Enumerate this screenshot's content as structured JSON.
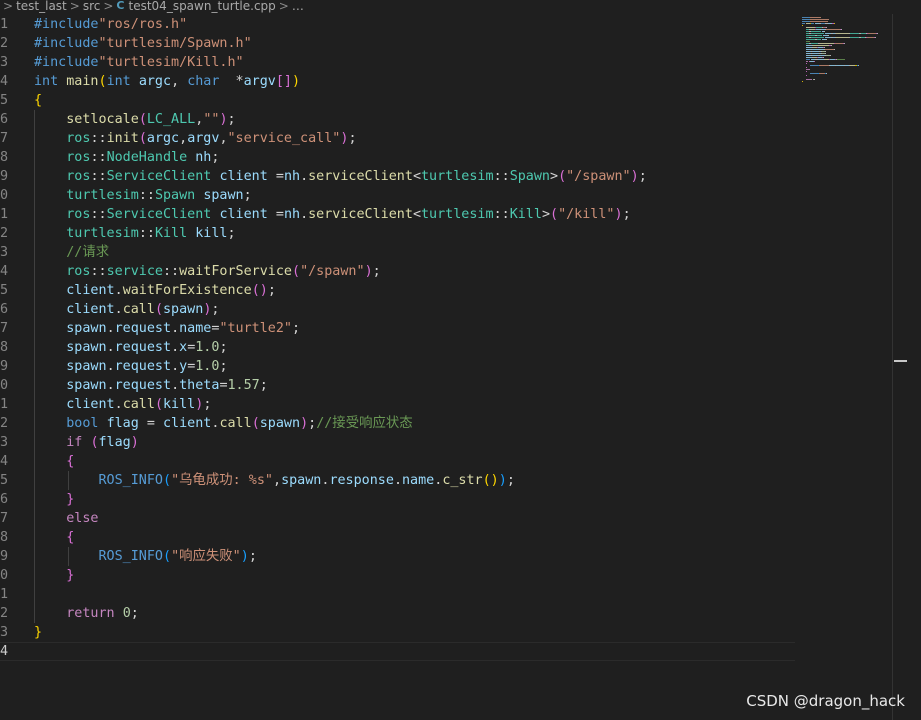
{
  "breadcrumb": {
    "items": [
      "test_last",
      "src",
      "test04_spawn_turtle.cpp",
      "…"
    ],
    "file_icon": "C",
    "separator": ">"
  },
  "editor": {
    "line_numbers": [
      "1",
      "2",
      "3",
      "4",
      "5",
      "6",
      "7",
      "8",
      "9",
      "0",
      "1",
      "2",
      "3",
      "4",
      "5",
      "6",
      "7",
      "8",
      "9",
      "0",
      "1",
      "2",
      "3",
      "4",
      "5",
      "6",
      "7",
      "8",
      "9",
      "0",
      "1",
      "2",
      "3",
      "4"
    ],
    "lines": [
      [
        [
          "mac",
          "#include"
        ],
        [
          "str",
          "\"ros/ros.h\""
        ]
      ],
      [
        [
          "mac",
          "#include"
        ],
        [
          "str",
          "\"turtlesim/Spawn.h\""
        ]
      ],
      [
        [
          "mac",
          "#include"
        ],
        [
          "str",
          "\"turtlesim/Kill.h\""
        ]
      ],
      [
        [
          "kw",
          "int"
        ],
        [
          "txt",
          " "
        ],
        [
          "fn",
          "main"
        ],
        [
          "br1",
          "("
        ],
        [
          "kw",
          "int"
        ],
        [
          "txt",
          " "
        ],
        [
          "var",
          "argc"
        ],
        [
          "txt",
          ", "
        ],
        [
          "kw",
          "char"
        ],
        [
          "txt",
          "  *"
        ],
        [
          "var",
          "argv"
        ],
        [
          "br2",
          "[]"
        ],
        [
          "br1",
          ")"
        ]
      ],
      [
        [
          "br1",
          "{"
        ]
      ],
      [
        [
          "txt",
          "    "
        ],
        [
          "fn",
          "setlocale"
        ],
        [
          "br2",
          "("
        ],
        [
          "ty",
          "LC_ALL"
        ],
        [
          "txt",
          ","
        ],
        [
          "str",
          "\"\""
        ],
        [
          "br2",
          ")"
        ],
        [
          "txt",
          ";"
        ]
      ],
      [
        [
          "txt",
          "    "
        ],
        [
          "ty",
          "ros"
        ],
        [
          "txt",
          "::"
        ],
        [
          "fn",
          "init"
        ],
        [
          "br2",
          "("
        ],
        [
          "var",
          "argc"
        ],
        [
          "txt",
          ","
        ],
        [
          "var",
          "argv"
        ],
        [
          "txt",
          ","
        ],
        [
          "str",
          "\"service_call\""
        ],
        [
          "br2",
          ")"
        ],
        [
          "txt",
          ";"
        ]
      ],
      [
        [
          "txt",
          "    "
        ],
        [
          "ty",
          "ros"
        ],
        [
          "txt",
          "::"
        ],
        [
          "ty",
          "NodeHandle"
        ],
        [
          "txt",
          " "
        ],
        [
          "var",
          "nh"
        ],
        [
          "txt",
          ";"
        ]
      ],
      [
        [
          "txt",
          "    "
        ],
        [
          "ty",
          "ros"
        ],
        [
          "txt",
          "::"
        ],
        [
          "ty",
          "ServiceClient"
        ],
        [
          "txt",
          " "
        ],
        [
          "var",
          "client"
        ],
        [
          "txt",
          " ="
        ],
        [
          "var",
          "nh"
        ],
        [
          "txt",
          "."
        ],
        [
          "fn",
          "serviceClient"
        ],
        [
          "txt",
          "<"
        ],
        [
          "ty",
          "turtlesim"
        ],
        [
          "txt",
          "::"
        ],
        [
          "ty",
          "Spawn"
        ],
        [
          "txt",
          ">"
        ],
        [
          "br2",
          "("
        ],
        [
          "str",
          "\"/spawn\""
        ],
        [
          "br2",
          ")"
        ],
        [
          "txt",
          ";"
        ]
      ],
      [
        [
          "txt",
          "    "
        ],
        [
          "ty",
          "turtlesim"
        ],
        [
          "txt",
          "::"
        ],
        [
          "ty",
          "Spawn"
        ],
        [
          "txt",
          " "
        ],
        [
          "var",
          "spawn"
        ],
        [
          "txt",
          ";"
        ]
      ],
      [
        [
          "txt",
          "    "
        ],
        [
          "ty",
          "ros"
        ],
        [
          "txt",
          "::"
        ],
        [
          "ty",
          "ServiceClient"
        ],
        [
          "txt",
          " "
        ],
        [
          "var",
          "client"
        ],
        [
          "txt",
          " ="
        ],
        [
          "var",
          "nh"
        ],
        [
          "txt",
          "."
        ],
        [
          "fn",
          "serviceClient"
        ],
        [
          "txt",
          "<"
        ],
        [
          "ty",
          "turtlesim"
        ],
        [
          "txt",
          "::"
        ],
        [
          "ty",
          "Kill"
        ],
        [
          "txt",
          ">"
        ],
        [
          "br2",
          "("
        ],
        [
          "str",
          "\"/kill\""
        ],
        [
          "br2",
          ")"
        ],
        [
          "txt",
          ";"
        ]
      ],
      [
        [
          "txt",
          "    "
        ],
        [
          "ty",
          "turtlesim"
        ],
        [
          "txt",
          "::"
        ],
        [
          "ty",
          "Kill"
        ],
        [
          "txt",
          " "
        ],
        [
          "var",
          "kill"
        ],
        [
          "txt",
          ";"
        ]
      ],
      [
        [
          "txt",
          "    "
        ],
        [
          "com",
          "//请求"
        ]
      ],
      [
        [
          "txt",
          "    "
        ],
        [
          "ty",
          "ros"
        ],
        [
          "txt",
          "::"
        ],
        [
          "ty",
          "service"
        ],
        [
          "txt",
          "::"
        ],
        [
          "fn",
          "waitForService"
        ],
        [
          "br2",
          "("
        ],
        [
          "str",
          "\"/spawn\""
        ],
        [
          "br2",
          ")"
        ],
        [
          "txt",
          ";"
        ]
      ],
      [
        [
          "txt",
          "    "
        ],
        [
          "var",
          "client"
        ],
        [
          "txt",
          "."
        ],
        [
          "fn",
          "waitForExistence"
        ],
        [
          "br2",
          "()"
        ],
        [
          "txt",
          ";"
        ]
      ],
      [
        [
          "txt",
          "    "
        ],
        [
          "var",
          "client"
        ],
        [
          "txt",
          "."
        ],
        [
          "fn",
          "call"
        ],
        [
          "br2",
          "("
        ],
        [
          "var",
          "spawn"
        ],
        [
          "br2",
          ")"
        ],
        [
          "txt",
          ";"
        ]
      ],
      [
        [
          "txt",
          "    "
        ],
        [
          "var",
          "spawn"
        ],
        [
          "txt",
          "."
        ],
        [
          "var",
          "request"
        ],
        [
          "txt",
          "."
        ],
        [
          "var",
          "name"
        ],
        [
          "txt",
          "="
        ],
        [
          "str",
          "\"turtle2\""
        ],
        [
          "txt",
          ";"
        ]
      ],
      [
        [
          "txt",
          "    "
        ],
        [
          "var",
          "spawn"
        ],
        [
          "txt",
          "."
        ],
        [
          "var",
          "request"
        ],
        [
          "txt",
          "."
        ],
        [
          "var",
          "x"
        ],
        [
          "txt",
          "="
        ],
        [
          "num",
          "1.0"
        ],
        [
          "txt",
          ";"
        ]
      ],
      [
        [
          "txt",
          "    "
        ],
        [
          "var",
          "spawn"
        ],
        [
          "txt",
          "."
        ],
        [
          "var",
          "request"
        ],
        [
          "txt",
          "."
        ],
        [
          "var",
          "y"
        ],
        [
          "txt",
          "="
        ],
        [
          "num",
          "1.0"
        ],
        [
          "txt",
          ";"
        ]
      ],
      [
        [
          "txt",
          "    "
        ],
        [
          "var",
          "spawn"
        ],
        [
          "txt",
          "."
        ],
        [
          "var",
          "request"
        ],
        [
          "txt",
          "."
        ],
        [
          "var",
          "theta"
        ],
        [
          "txt",
          "="
        ],
        [
          "num",
          "1.57"
        ],
        [
          "txt",
          ";"
        ]
      ],
      [
        [
          "txt",
          "    "
        ],
        [
          "var",
          "client"
        ],
        [
          "txt",
          "."
        ],
        [
          "fn",
          "call"
        ],
        [
          "br2",
          "("
        ],
        [
          "var",
          "kill"
        ],
        [
          "br2",
          ")"
        ],
        [
          "txt",
          ";"
        ]
      ],
      [
        [
          "txt",
          "    "
        ],
        [
          "kw",
          "bool"
        ],
        [
          "txt",
          " "
        ],
        [
          "var",
          "flag"
        ],
        [
          "txt",
          " = "
        ],
        [
          "var",
          "client"
        ],
        [
          "txt",
          "."
        ],
        [
          "fn",
          "call"
        ],
        [
          "br2",
          "("
        ],
        [
          "var",
          "spawn"
        ],
        [
          "br2",
          ")"
        ],
        [
          "txt",
          ";"
        ],
        [
          "com",
          "//接受响应状态"
        ]
      ],
      [
        [
          "txt",
          "    "
        ],
        [
          "ctl",
          "if"
        ],
        [
          "txt",
          " "
        ],
        [
          "br2",
          "("
        ],
        [
          "var",
          "flag"
        ],
        [
          "br2",
          ")"
        ]
      ],
      [
        [
          "txt",
          "    "
        ],
        [
          "br2",
          "{"
        ]
      ],
      [
        [
          "txt",
          "        "
        ],
        [
          "mac",
          "ROS_INFO"
        ],
        [
          "br3",
          "("
        ],
        [
          "str",
          "\"乌龟成功: %s\""
        ],
        [
          "txt",
          ","
        ],
        [
          "var",
          "spawn"
        ],
        [
          "txt",
          "."
        ],
        [
          "var",
          "response"
        ],
        [
          "txt",
          "."
        ],
        [
          "var",
          "name"
        ],
        [
          "txt",
          "."
        ],
        [
          "fn",
          "c_str"
        ],
        [
          "br1",
          "()"
        ],
        [
          "br3",
          ")"
        ],
        [
          "txt",
          ";"
        ]
      ],
      [
        [
          "txt",
          "    "
        ],
        [
          "br2",
          "}"
        ]
      ],
      [
        [
          "txt",
          "    "
        ],
        [
          "ctl",
          "else"
        ]
      ],
      [
        [
          "txt",
          "    "
        ],
        [
          "br2",
          "{"
        ]
      ],
      [
        [
          "txt",
          "        "
        ],
        [
          "mac",
          "ROS_INFO"
        ],
        [
          "br3",
          "("
        ],
        [
          "str",
          "\"响应失败\""
        ],
        [
          "br3",
          ")"
        ],
        [
          "txt",
          ";"
        ]
      ],
      [
        [
          "txt",
          "    "
        ],
        [
          "br2",
          "}"
        ]
      ],
      [],
      [
        [
          "txt",
          "    "
        ],
        [
          "ctl",
          "return"
        ],
        [
          "txt",
          " "
        ],
        [
          "num",
          "0"
        ],
        [
          "txt",
          ";"
        ]
      ],
      [
        [
          "br1",
          "}"
        ]
      ],
      []
    ]
  },
  "colors": {
    "background": "#1f1f1f",
    "keyword": "#569cd6",
    "control": "#c586c0",
    "type": "#4ec9b0",
    "function": "#dcdcaa",
    "variable": "#9cdcfe",
    "string": "#ce9178",
    "number": "#b5cea8",
    "comment": "#6a9955"
  },
  "watermark": "CSDN @dragon_hack"
}
